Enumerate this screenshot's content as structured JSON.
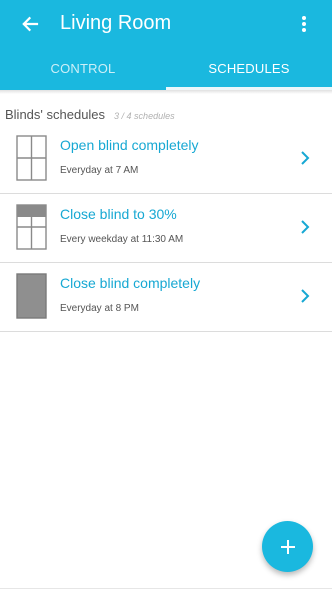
{
  "header": {
    "title": "Living Room",
    "tabs": [
      {
        "label": "CONTROL",
        "active": false
      },
      {
        "label": "SCHEDULES",
        "active": true
      }
    ]
  },
  "section": {
    "title": "Blinds' schedules",
    "count": "3 / 4 schedules"
  },
  "schedules": [
    {
      "name": "Open blind completely",
      "when": "Everyday at 7 AM",
      "icon": "blind-open-icon"
    },
    {
      "name": "Close blind to 30%",
      "when": "Every weekday at 11:30 AM",
      "icon": "blind-30-percent-icon"
    },
    {
      "name": "Close blind completely",
      "when": "Everyday at 8 PM",
      "icon": "blind-closed-icon"
    }
  ],
  "colors": {
    "accent": "#1ab8df",
    "link": "#17a8d3"
  }
}
